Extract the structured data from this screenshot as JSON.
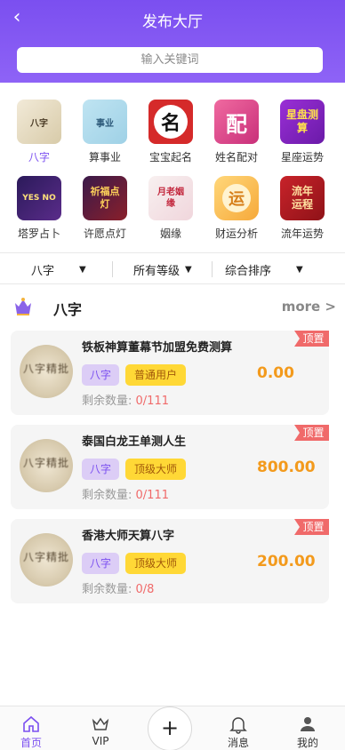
{
  "header": {
    "title": "发布大厅",
    "search_placeholder": "输入关键词"
  },
  "categories": [
    {
      "label": "八字",
      "icon": "bazi-icon",
      "icon_text": "八字"
    },
    {
      "label": "算事业",
      "icon": "career-icon",
      "icon_text": "事业"
    },
    {
      "label": "宝宝起名",
      "icon": "baby-naming-icon",
      "icon_text": "名"
    },
    {
      "label": "姓名配对",
      "icon": "name-match-icon",
      "icon_text": "配"
    },
    {
      "label": "星座运势",
      "icon": "horoscope-icon",
      "icon_text": "星盘测算"
    },
    {
      "label": "塔罗占卜",
      "icon": "tarot-icon",
      "icon_text": "YES NO"
    },
    {
      "label": "许愿点灯",
      "icon": "wish-lamp-icon",
      "icon_text": "祈福点灯"
    },
    {
      "label": "姻缘",
      "icon": "marriage-icon",
      "icon_text": "月老姻缘"
    },
    {
      "label": "财运分析",
      "icon": "wealth-icon",
      "icon_text": "运"
    },
    {
      "label": "流年运势",
      "icon": "yearly-fortune-icon",
      "icon_text": "流年运程"
    }
  ],
  "filters": [
    {
      "label": "八字"
    },
    {
      "label": "所有等级"
    },
    {
      "label": "综合排序"
    }
  ],
  "section": {
    "title": "八字",
    "more": "more >"
  },
  "listings": [
    {
      "title": "铁板神算董幕节加盟免费测算",
      "category_tag": "八字",
      "level_tag": "普通用户",
      "price": "0.00",
      "remaining_label": "剩余数量:",
      "remaining": "0/111",
      "pin": "顶置",
      "thumb_text": "八字精批"
    },
    {
      "title": "泰国白龙王单测人生",
      "category_tag": "八字",
      "level_tag": "顶级大师",
      "price": "800.00",
      "remaining_label": "剩余数量:",
      "remaining": "0/111",
      "pin": "顶置",
      "thumb_text": "八字精批"
    },
    {
      "title": "香港大师天算八字",
      "category_tag": "八字",
      "level_tag": "顶级大师",
      "price": "200.00",
      "remaining_label": "剩余数量:",
      "remaining": "0/8",
      "pin": "顶置",
      "thumb_text": "八字精批"
    }
  ],
  "tabbar": [
    {
      "label": "首页",
      "icon": "home-icon"
    },
    {
      "label": "VIP",
      "icon": "crown-icon"
    },
    {
      "label": "+",
      "icon": "plus-icon"
    },
    {
      "label": "消息",
      "icon": "bell-icon"
    },
    {
      "label": "我的",
      "icon": "user-icon"
    }
  ],
  "colors": {
    "accent": "#7b4ff0",
    "price": "#f39a1c",
    "pin": "#f06a6a",
    "level_tag": "#ffd836",
    "category_tag": "#dccdf6"
  }
}
